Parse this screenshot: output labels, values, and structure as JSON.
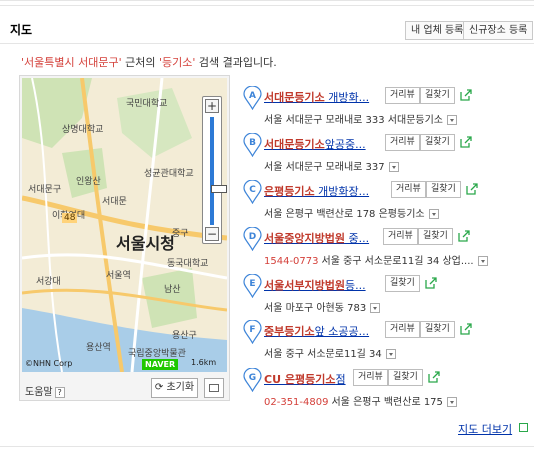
{
  "section": {
    "title": "지도",
    "btn_register": "내 업체 등록",
    "btn_new_place": "신규장소 등록"
  },
  "summary": {
    "region": "'서울특별시 서대문구'",
    "middle": " 근처의 ",
    "keyword": "'등기소'",
    "suffix": " 검색 결과입니다."
  },
  "map": {
    "labels": [
      "국민대학교",
      "상명대학교",
      "인왕산",
      "서대문구",
      "성균관대학교",
      "서대문",
      "서울시청",
      "중구",
      "이화여대",
      "서강대",
      "서울역",
      "동국대학교",
      "남산",
      "용산역",
      "국립중앙박물관",
      "용산구"
    ],
    "road_number": "48",
    "copyright": "©NHN Corp",
    "brand": "NAVER",
    "scale": "1.6km",
    "zoom_in": "+",
    "zoom_out": "−",
    "help_label": "도움말",
    "help_q": "?",
    "reset_label": "초기화"
  },
  "results": [
    {
      "letter": "A",
      "keyword": "서대문등기소",
      "rest": " 개방화...",
      "btn1": "거리뷰",
      "btn2": "길찾기",
      "phone": "",
      "address": "서울 서대문구 모래내로 333 서대문등기소"
    },
    {
      "letter": "B",
      "keyword": "서대문등기소",
      "rest": "앞공중...",
      "btn1": "거리뷰",
      "btn2": "길찾기",
      "phone": "",
      "address": "서울 서대문구 모래내로 337"
    },
    {
      "letter": "C",
      "keyword": "은평등기소",
      "rest": " 개방화장...",
      "btn1": "거리뷰",
      "btn2": "길찾기",
      "phone": "",
      "address": "서울 은평구 백련산로 178 은평등기소"
    },
    {
      "letter": "D",
      "keyword": "서울중앙지방법원",
      "rest": " 중...",
      "btn1": "거리뷰",
      "btn2": "길찾기",
      "phone": "1544-0773",
      "address": "서울 중구 서소문로11길 34 상업...."
    },
    {
      "letter": "E",
      "keyword": "서울서부지방법원",
      "rest": "등...",
      "btn1": "",
      "btn2": "길찾기",
      "phone": "",
      "address": "서울 마포구 아현동 783"
    },
    {
      "letter": "F",
      "keyword": "중부등기소",
      "rest": "앞 소공공...",
      "btn1": "거리뷰",
      "btn2": "길찾기",
      "phone": "",
      "address": "서울 중구 서소문로11길 34"
    },
    {
      "letter": "G",
      "keyword": "CU 은평등기소",
      "rest": "점",
      "btn1": "거리뷰",
      "btn2": "길찾기",
      "phone": "02-351-4809",
      "address": "서울 은평구 백련산로 175"
    }
  ],
  "more_link": "지도 더보기",
  "colors": {
    "marker": "#3d84d8",
    "link": "#0033aa",
    "accent_red": "#d4403a",
    "share_green": "#2aa84a",
    "naver_green": "#1ec800"
  }
}
